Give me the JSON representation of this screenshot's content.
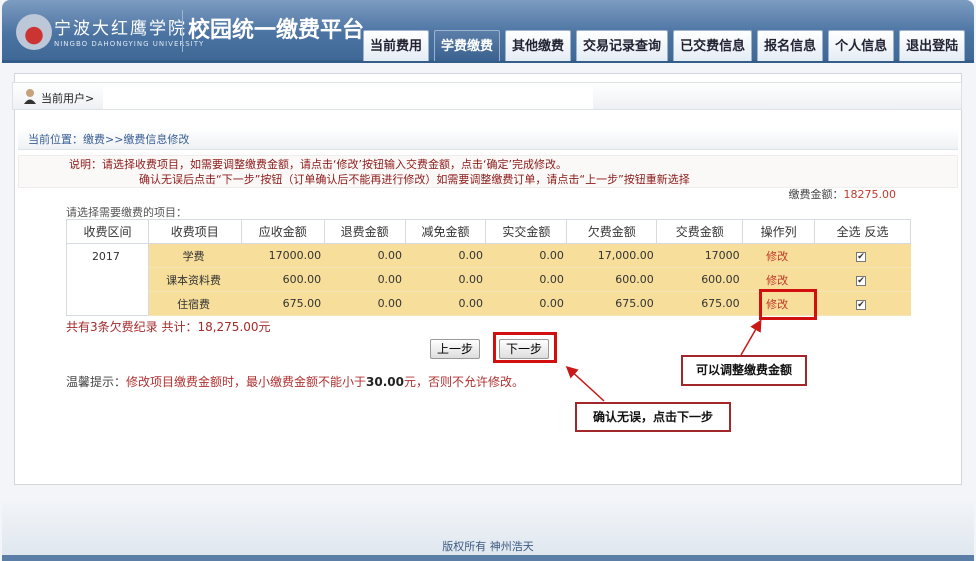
{
  "header": {
    "school_name": "宁波大红鹰学院",
    "school_name_en": "NINGBO DAHONGYING UNIVERSITY",
    "platform_title": "校园统一缴费平台",
    "tabs": [
      {
        "label": "当前费用"
      },
      {
        "label": "学费缴费",
        "active": true
      },
      {
        "label": "其他缴费"
      },
      {
        "label": "交易记录查询"
      },
      {
        "label": "已交费信息"
      },
      {
        "label": "报名信息"
      },
      {
        "label": "个人信息"
      },
      {
        "label": "退出登陆"
      }
    ]
  },
  "user": {
    "label": "当前用户>"
  },
  "breadcrumb": "当前位置：缴费>>缴费信息修改",
  "notice": {
    "line1": "说明：请选择收费项目，如需要调整缴费金额，请点击‘修改’按钮输入交费金额，点击‘确定’完成修改。",
    "line2": "确认无误后点击“下一步”按钮（订单确认后不能再进行修改）如需要调整缴费订单，请点击“上一步”按钮重新选择"
  },
  "amount": {
    "label": "缴费金额：",
    "value": "18275.00"
  },
  "choose_label": "请选择需要缴费的项目：",
  "table": {
    "headers": [
      "收费区间",
      "收费项目",
      "应收金额",
      "退费金额",
      "减免金额",
      "实交金额",
      "欠费金额",
      "交费金额",
      "操作列",
      "全选 反选"
    ],
    "year": "2017",
    "rows": [
      {
        "item": "学费",
        "due": "17000.00",
        "refund": "0.00",
        "waive": "0.00",
        "paid": "0.00",
        "owed": "17,000.00",
        "pay": "17000",
        "action": "修改",
        "checked": true
      },
      {
        "item": "课本资料费",
        "due": "600.00",
        "refund": "0.00",
        "waive": "0.00",
        "paid": "0.00",
        "owed": "600.00",
        "pay": "600.00",
        "action": "修改",
        "checked": true
      },
      {
        "item": "住宿费",
        "due": "675.00",
        "refund": "0.00",
        "waive": "0.00",
        "paid": "0.00",
        "owed": "675.00",
        "pay": "675.00",
        "action": "修改",
        "checked": true
      }
    ]
  },
  "total": "共有3条欠费纪录  共计：18,275.00元",
  "buttons": {
    "prev": "上一步",
    "next": "下一步"
  },
  "tip": {
    "label": "温馨提示：",
    "text1": "修改项目缴费金额时，最小缴费金额不能小于",
    "amount": "30.00",
    "text2": "元，否则不允许修改。"
  },
  "annotations": {
    "adjust": "可以调整缴费金额",
    "confirm": "确认无误，点击下一步"
  },
  "footer": "版权所有 神州浩天"
}
